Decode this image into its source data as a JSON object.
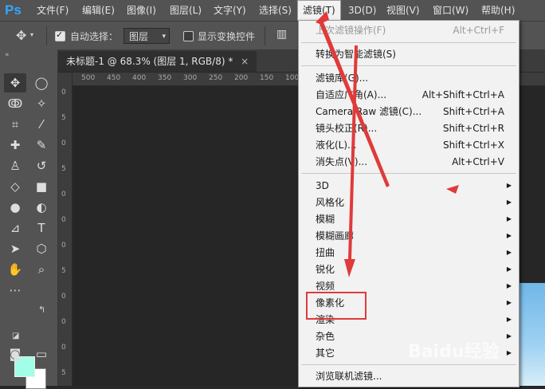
{
  "app": {
    "logo": "Ps"
  },
  "menubar": {
    "items": [
      "文件(F)",
      "编辑(E)",
      "图像(I)",
      "图层(L)",
      "文字(Y)",
      "选择(S)",
      "滤镜(T)",
      "3D(D)",
      "视图(V)",
      "窗口(W)",
      "帮助(H)"
    ],
    "active": "滤镜(T)"
  },
  "options": {
    "auto_select_label": "自动选择：",
    "auto_select_checked": true,
    "layer_select_value": "图层",
    "show_transform_label": "显示变换控件",
    "show_transform_checked": false
  },
  "document": {
    "tab_title": "未标题-1 @ 68.3% (图层 1, RGB/8) *",
    "close_glyph": "×"
  },
  "ruler": {
    "h_ticks": [
      "500",
      "450",
      "400",
      "350",
      "300",
      "250",
      "200",
      "150",
      "100"
    ],
    "v_ticks": [
      "0",
      "5",
      "0",
      "5",
      "0",
      "0",
      "0",
      "5",
      "0",
      "0",
      "0",
      "5"
    ]
  },
  "filter_menu": {
    "last_filter": {
      "label": "上次滤镜操作(F)",
      "shortcut": "Alt+Ctrl+F"
    },
    "smart_filters": {
      "label": "转换为智能滤镜(S)"
    },
    "group1": [
      {
        "label": "滤镜库(G)...",
        "shortcut": ""
      },
      {
        "label": "自适应广角(A)...",
        "shortcut": "Alt+Shift+Ctrl+A"
      },
      {
        "label": "Camera Raw 滤镜(C)...",
        "shortcut": "Shift+Ctrl+A"
      },
      {
        "label": "镜头校正(R)...",
        "shortcut": "Shift+Ctrl+R"
      },
      {
        "label": "液化(L)...",
        "shortcut": "Shift+Ctrl+X"
      },
      {
        "label": "消失点(V)...",
        "shortcut": "Alt+Ctrl+V"
      }
    ],
    "submenus": [
      "3D",
      "风格化",
      "模糊",
      "模糊画廊",
      "扭曲",
      "锐化",
      "视频",
      "像素化",
      "渲染",
      "杂色",
      "其它"
    ],
    "browse": "浏览联机滤镜..."
  },
  "watermark": "Baidu经验",
  "colors": {
    "foreground": "#a0ffe6",
    "background": "#ffffff",
    "highlight": "#e03a3a"
  }
}
